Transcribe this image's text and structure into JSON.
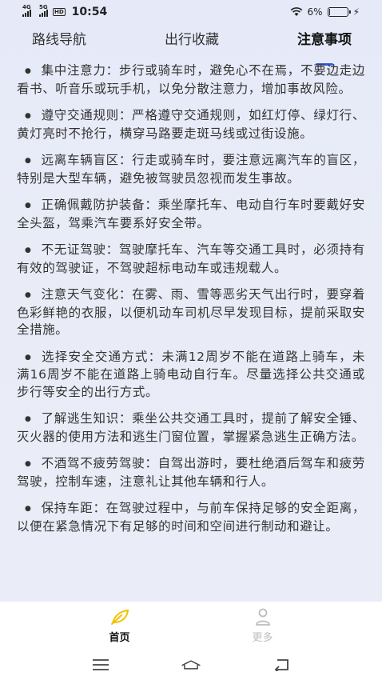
{
  "status_bar": {
    "net1": "4G",
    "net2": "5G",
    "hd": "HD",
    "time": "10:54",
    "battery": "6%"
  },
  "tabs": [
    {
      "label": "路线导航",
      "active": false
    },
    {
      "label": "出行收藏",
      "active": false
    },
    {
      "label": "注意事项",
      "active": true
    }
  ],
  "tips": [
    "集中注意力：步行或骑车时，避免心不在焉，不要边走边看书、听音乐或玩手机，以免分散注意力，增加事故风险。",
    "遵守交通规则：严格遵守交通规则，如红灯停、绿灯行、黄灯亮时不抢行，横穿马路要走斑马线或过街设施。",
    "远离车辆盲区：行走或骑车时，要注意远离汽车的盲区，特别是大型车辆，避免被驾驶员忽视而发生事故。",
    "正确佩戴防护装备：乘坐摩托车、电动自行车时要戴好安全头盔，驾乘汽车要系好安全带。",
    "不无证驾驶：驾驶摩托车、汽车等交通工具时，必须持有有效的驾驶证，不驾驶超标电动车或违规载人。",
    "注意天气变化：在雾、雨、雪等恶劣天气出行时，要穿着色彩鲜艳的衣服，以便机动车司机尽早发现目标，提前采取安全措施。",
    "选择安全交通方式：未满12周岁不能在道路上骑车，未满16周岁不能在道路上骑电动自行车。尽量选择公共交通或步行等安全的出行方式。",
    "了解逃生知识：乘坐公共交通工具时，提前了解安全锤、灭火器的使用方法和逃生门窗位置，掌握紧急逃生正确方法。",
    "不酒驾不疲劳驾驶：自驾出游时，要杜绝酒后驾车和疲劳驾驶，控制车速，注意礼让其他车辆和行人。",
    "保持车距：在驾驶过程中，与前车保持足够的安全距离，以便在紧急情况下有足够的时间和空间进行制动和避让。"
  ],
  "bullet": "●",
  "bottom_nav": {
    "home": {
      "label": "首页",
      "icon": "leaf-icon",
      "color": "#f2c200"
    },
    "more": {
      "label": "更多",
      "icon": "person-icon",
      "color": "#bdbdbd"
    }
  },
  "colors": {
    "accent": "#2f5fe0",
    "home_icon": "#f2c200"
  }
}
